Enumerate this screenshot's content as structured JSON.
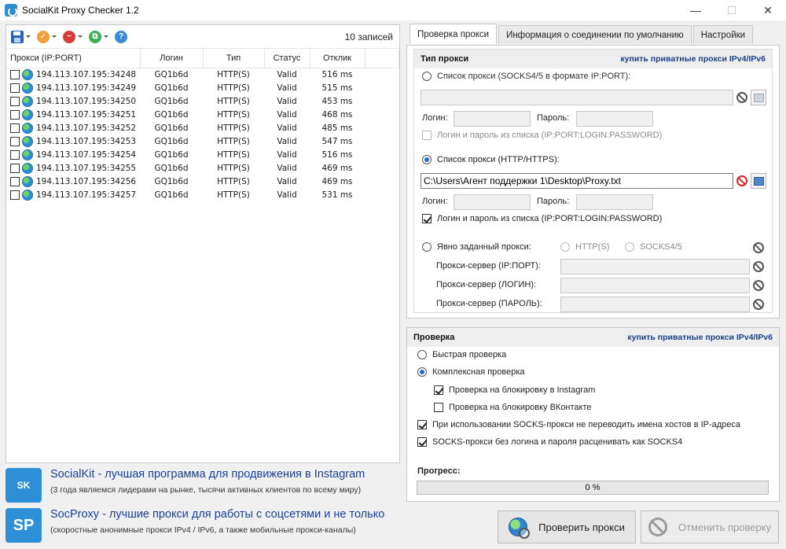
{
  "window": {
    "title": "SocialKit Proxy Checker 1.2",
    "minimize": "—",
    "maximize": "☐",
    "close": "✕"
  },
  "toolbar": {
    "records_label": "10 записей"
  },
  "proxy_table": {
    "columns": [
      "Прокси (IP:PORT)",
      "Логин",
      "Тип",
      "Статус",
      "Отклик"
    ],
    "rows": [
      {
        "proxy": "194.113.107.195:34248",
        "login": "GQ1b6d",
        "type": "HTTP(S)",
        "status": "Valid",
        "response": "516 ms"
      },
      {
        "proxy": "194.113.107.195:34249",
        "login": "GQ1b6d",
        "type": "HTTP(S)",
        "status": "Valid",
        "response": "515 ms"
      },
      {
        "proxy": "194.113.107.195:34250",
        "login": "GQ1b6d",
        "type": "HTTP(S)",
        "status": "Valid",
        "response": "453 ms"
      },
      {
        "proxy": "194.113.107.195:34251",
        "login": "GQ1b6d",
        "type": "HTTP(S)",
        "status": "Valid",
        "response": "468 ms"
      },
      {
        "proxy": "194.113.107.195:34252",
        "login": "GQ1b6d",
        "type": "HTTP(S)",
        "status": "Valid",
        "response": "485 ms"
      },
      {
        "proxy": "194.113.107.195:34253",
        "login": "GQ1b6d",
        "type": "HTTP(S)",
        "status": "Valid",
        "response": "547 ms"
      },
      {
        "proxy": "194.113.107.195:34254",
        "login": "GQ1b6d",
        "type": "HTTP(S)",
        "status": "Valid",
        "response": "516 ms"
      },
      {
        "proxy": "194.113.107.195:34255",
        "login": "GQ1b6d",
        "type": "HTTP(S)",
        "status": "Valid",
        "response": "469 ms"
      },
      {
        "proxy": "194.113.107.195:34256",
        "login": "GQ1b6d",
        "type": "HTTP(S)",
        "status": "Valid",
        "response": "469 ms"
      },
      {
        "proxy": "194.113.107.195:34257",
        "login": "GQ1b6d",
        "type": "HTTP(S)",
        "status": "Valid",
        "response": "531 ms"
      }
    ]
  },
  "tabs": [
    "Проверка прокси",
    "Информация о соединении по умолчанию",
    "Настройки"
  ],
  "proxy_type": {
    "title": "Тип прокси",
    "buy_link": "купить приватные прокси IPv4/IPv6",
    "socks_list_label": "Список прокси (SOCKS4/5 в формате IP:PORT):",
    "socks_file": "",
    "login_label": "Логин:",
    "password_label": "Пароль:",
    "login_from_list_label": "Логин и пароль из списка (IP:PORT:LOGIN:PASSWORD)",
    "http_list_label": "Список прокси (HTTP/HTTPS):",
    "http_file": "C:\\Users\\Агент поддержки 1\\Desktop\\Proxy.txt",
    "explicit_label": "Явно заданный прокси:",
    "http_option": "HTTP(S)",
    "socks_option": "SOCKS4/5",
    "server_ip_label": "Прокси-сервер (IP:ПОРТ):",
    "server_login_label": "Прокси-сервер (ЛОГИН):",
    "server_password_label": "Прокси-сервер (ПАРОЛЬ):"
  },
  "check": {
    "title": "Проверка",
    "buy_link": "купить приватные прокси IPv4/IPv6",
    "quick_label": "Быстрая проверка",
    "complex_label": "Комплексная проверка",
    "instagram_label": "Проверка на блокировку в Instagram",
    "vk_label": "Проверка на блокировку ВКонтакте",
    "socks_hosts_label": "При использовании SOCKS-прокси не переводить имена хостов в IP-адреса",
    "socks4_label": "SOCKS-прокси без логина и пароля расценивать как SOCKS4",
    "progress_label": "Прогресс:",
    "progress_text": "0 %",
    "progress_value": 0
  },
  "promos": {
    "socialkit_logo": "SK",
    "socialkit_title": "SocialKit - лучшая программа для продвижения в Instagram",
    "socialkit_sub": "(3 года являемся лидерами на рынке, тысячи активных клиентов по всему миру)",
    "socproxy_logo": "SP",
    "socproxy_title": "SocProxy - лучшие прокси для работы с соцсетями и не только",
    "socproxy_sub": "(скоростные анонимные прокси IPv4 / IPv6, а также мобильные прокси-каналы)"
  },
  "buttons": {
    "check": "Проверить прокси",
    "cancel": "Отменить проверку"
  },
  "colors": {
    "accent": "#2a67c6",
    "link": "#1c3f87",
    "promo_title": "#1b3f98",
    "danger": "#d0262e"
  }
}
